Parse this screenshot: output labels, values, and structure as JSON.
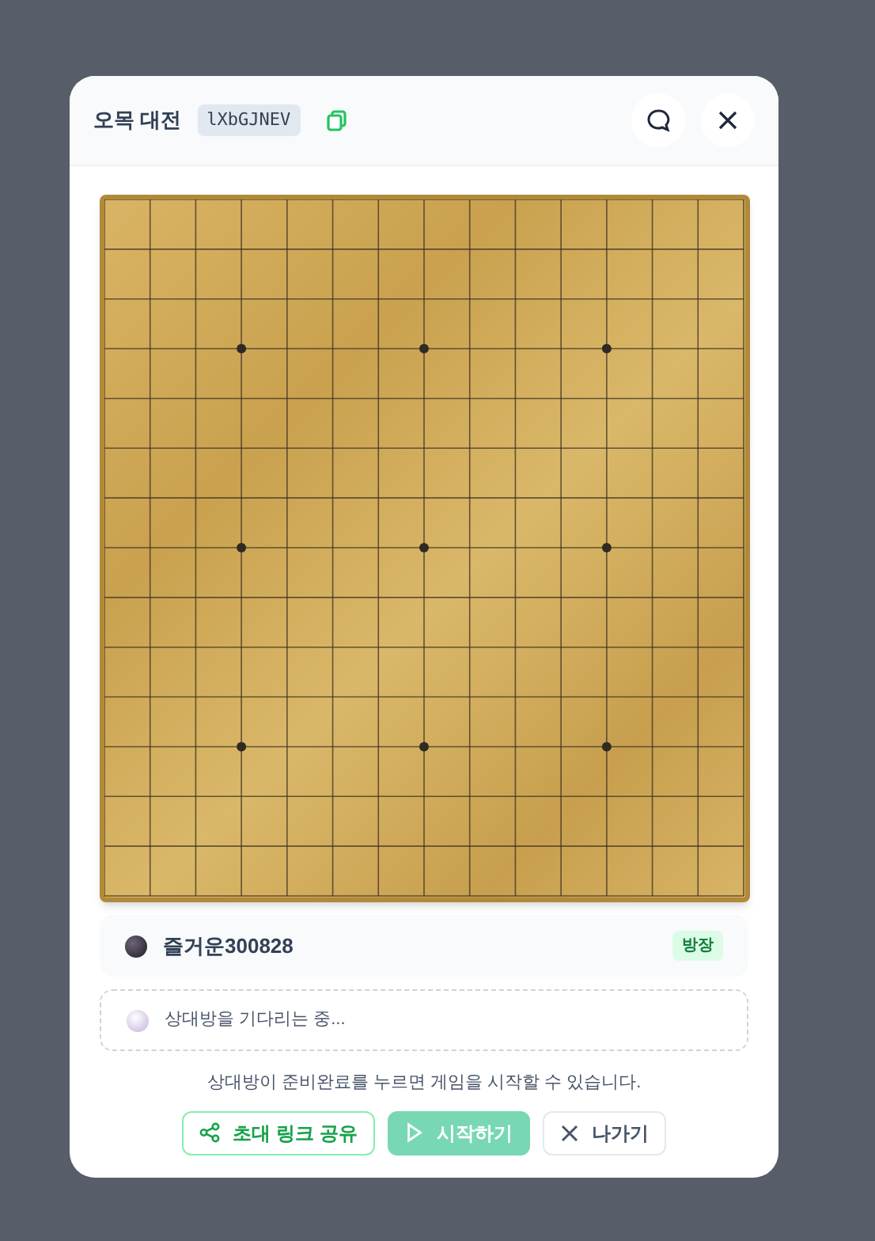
{
  "header": {
    "title": "오목 대전",
    "room_code": "lXbGJNEV"
  },
  "players": [
    {
      "kind": "joined",
      "name": "즐거운300828",
      "badge": "방장"
    },
    {
      "kind": "waiting",
      "name": "상대방을 기다리는 중..."
    }
  ],
  "notice": "상대방이 준비완료를 누르면 게임을 시작할 수 있습니다.",
  "buttons": [
    {
      "kind": "share",
      "label": "초대 링크 공유",
      "disabled": false
    },
    {
      "kind": "start",
      "label": "시작하기",
      "disabled": true
    },
    {
      "kind": "leave",
      "label": "나가기",
      "disabled": false
    }
  ]
}
